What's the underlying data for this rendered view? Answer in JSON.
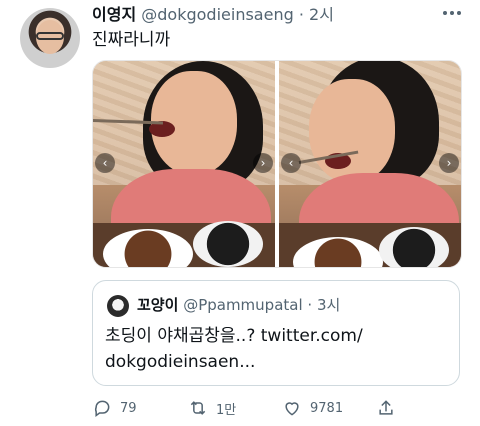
{
  "tweet": {
    "display_name": "이영지",
    "handle": "@dokgodieinsaeng",
    "separator": "·",
    "time": "2시",
    "text": "진짜라니까"
  },
  "media": {
    "count": 2
  },
  "quote": {
    "display_name": "꼬양이",
    "handle": "@Ppammupatal",
    "separator": "·",
    "time": "3시",
    "text_line1": "초딩이 야채곱창을..? twitter.com/",
    "text_line2": "dokgodieinsaen..."
  },
  "actions": {
    "replies": "79",
    "retweets": "1만",
    "likes": "9781"
  },
  "icons": {
    "more": "more-icon",
    "reply": "reply-icon",
    "retweet": "retweet-icon",
    "like": "heart-icon",
    "share": "share-icon",
    "prev": "chevron-left-icon",
    "next": "chevron-right-icon"
  }
}
